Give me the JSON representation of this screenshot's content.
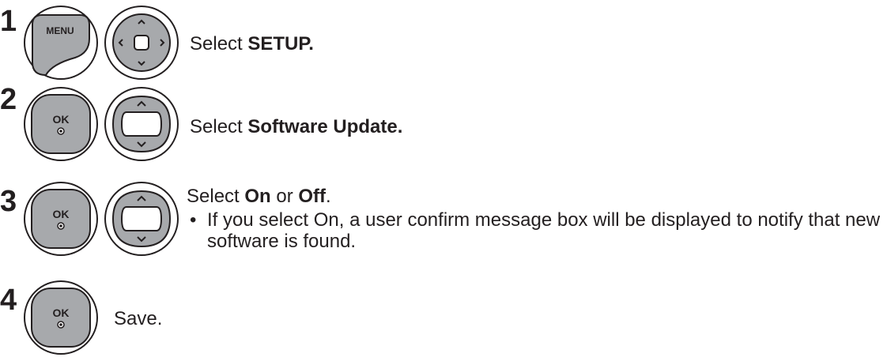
{
  "steps": [
    {
      "number": "1",
      "buttons": [
        "menu-button",
        "dpad-4way"
      ],
      "menu_label": "MENU",
      "text_prefix": "Select ",
      "text_bold": "SETUP."
    },
    {
      "number": "2",
      "buttons": [
        "ok-button",
        "dpad-updown"
      ],
      "ok_label": "OK",
      "text_prefix": "Select ",
      "text_bold": "Software Update."
    },
    {
      "number": "3",
      "buttons": [
        "ok-button",
        "dpad-updown"
      ],
      "ok_label": "OK",
      "text_prefix": "Select ",
      "text_bold1": "On",
      "text_mid": " or ",
      "text_bold2": "Off",
      "text_suffix": ".",
      "bullet": "•",
      "note": "If you select On, a user confirm message box will be displayed to notify that new software is found."
    },
    {
      "number": "4",
      "buttons": [
        "ok-button"
      ],
      "ok_label": "OK",
      "text": "Save."
    }
  ]
}
